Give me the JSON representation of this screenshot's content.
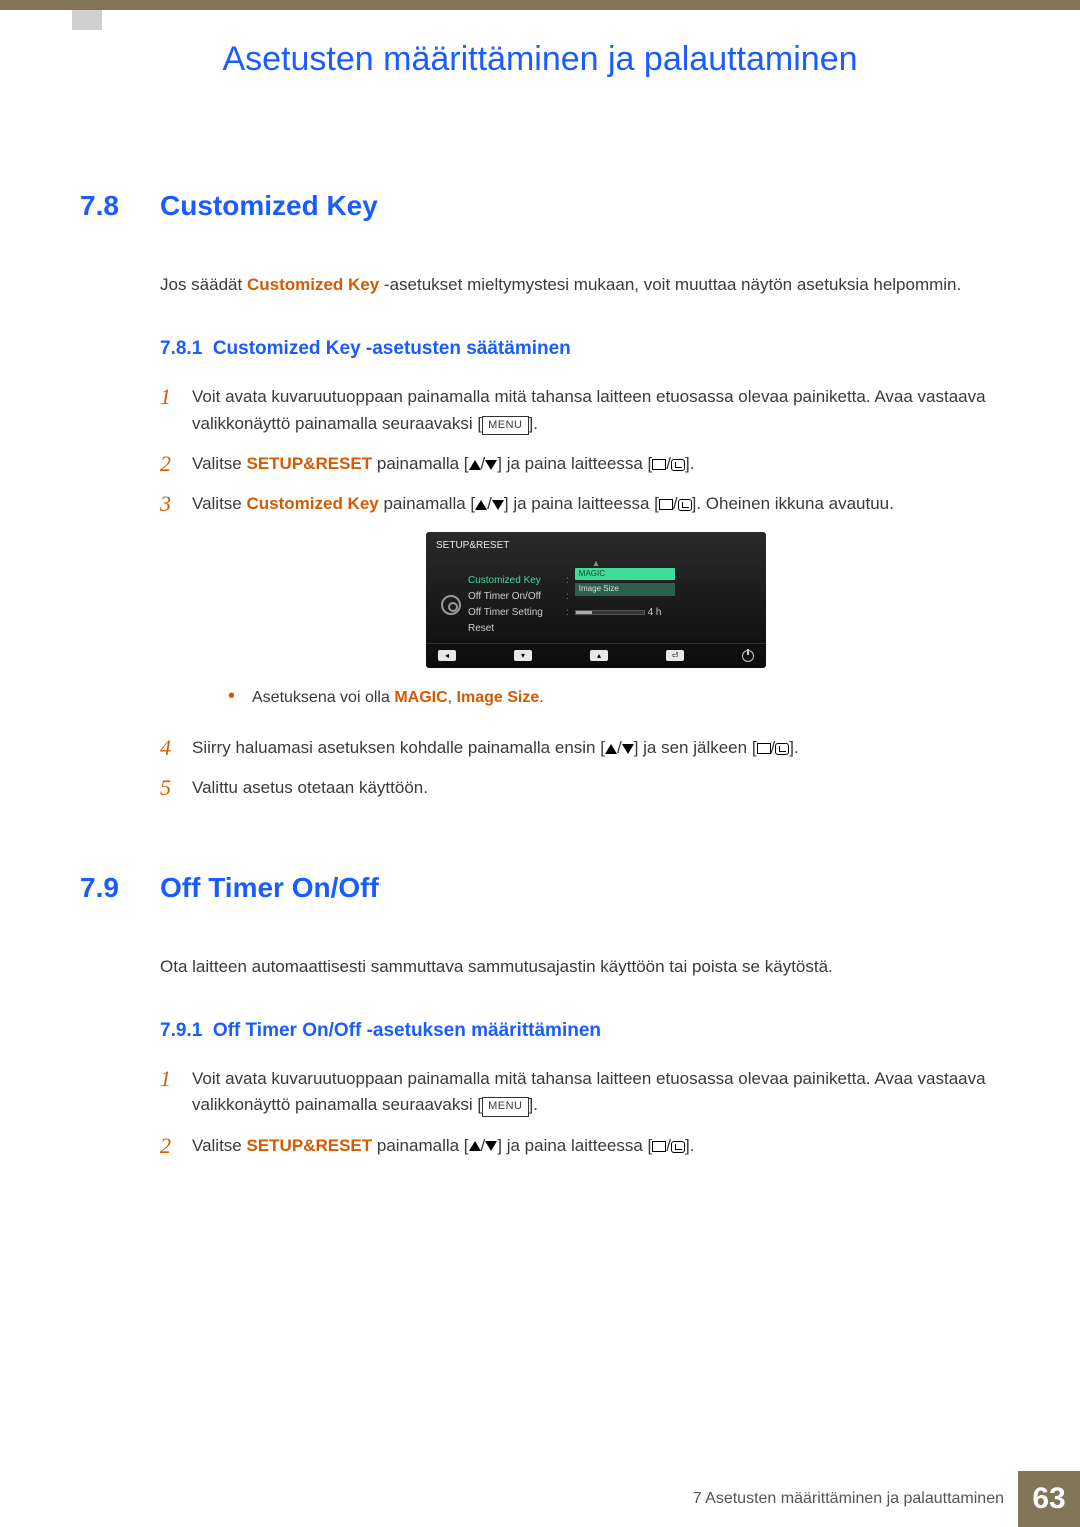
{
  "chapter_title": "Asetusten määrittäminen ja palauttaminen",
  "sect78": {
    "num": "7.8",
    "title": "Customized Key",
    "intro_before": "Jos säädät ",
    "intro_emph": "Customized Key",
    "intro_after": " -asetukset mieltymystesi mukaan, voit muuttaa näytön asetuksia helpommin.",
    "sub_num": "7.8.1",
    "sub_title": "Customized Key -asetusten säätäminen",
    "step1a": "Voit avata kuvaruutuoppaan painamalla mitä tahansa laitteen etuosassa olevaa painiketta. Avaa vastaava valikkonäyttö painamalla seuraavaksi [",
    "menu_label": "MENU",
    "step1b": "].",
    "step2a": "Valitse ",
    "step2_emph": "SETUP&RESET",
    "step2b": " painamalla [",
    "step2c": "] ja paina laitteessa [",
    "step2d": "].",
    "step3a": "Valitse ",
    "step3_emph": "Customized Key",
    "step3b": " painamalla [",
    "step3c": "] ja paina laitteessa [",
    "step3d": "]. Oheinen ikkuna avautuu.",
    "bullet_a": "Asetuksena voi olla ",
    "bullet_emph1": "MAGIC",
    "bullet_sep": ", ",
    "bullet_emph2": "Image Size",
    "bullet_end": ".",
    "step4a": "Siirry haluamasi asetuksen kohdalle painamalla ensin [",
    "step4b": "] ja sen jälkeen [",
    "step4c": "].",
    "step5": "Valittu asetus otetaan käyttöön."
  },
  "osd": {
    "title": "SETUP&RESET",
    "items": [
      "Customized Key",
      "Off Timer On/Off",
      "Off Timer Setting",
      "Reset"
    ],
    "magic": "MAGIC",
    "imagesize": "Image Size",
    "timer_val": "4 h"
  },
  "sect79": {
    "num": "7.9",
    "title": "Off Timer On/Off",
    "intro": "Ota laitteen automaattisesti sammuttava sammutusajastin käyttöön tai poista se käytöstä.",
    "sub_num": "7.9.1",
    "sub_title": "Off Timer On/Off -asetuksen määrittäminen",
    "step1a": "Voit avata kuvaruutuoppaan painamalla mitä tahansa laitteen etuosassa olevaa painiketta. Avaa vastaava valikkonäyttö painamalla seuraavaksi [",
    "step1b": "].",
    "step2a": "Valitse ",
    "step2_emph": "SETUP&RESET",
    "step2b": " painamalla [",
    "step2c": "] ja paina laitteessa [",
    "step2d": "]."
  },
  "footer": {
    "text": "7 Asetusten määrittäminen ja palauttaminen",
    "page": "63"
  }
}
